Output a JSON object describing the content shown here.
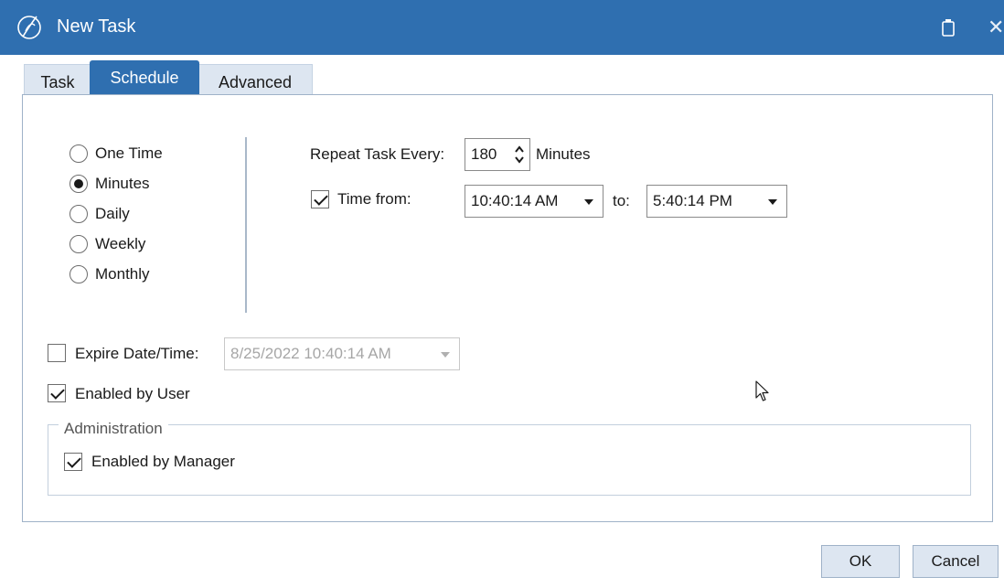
{
  "window": {
    "title": "New Task",
    "logo_icon": "app-logo-icon",
    "accent": "#2f6fb0"
  },
  "tabs": [
    {
      "label": "Task",
      "active": false
    },
    {
      "label": "Schedule",
      "active": true
    },
    {
      "label": "Advanced",
      "active": false
    }
  ],
  "frequency": {
    "options": [
      {
        "label": "One Time",
        "selected": false
      },
      {
        "label": "Minutes",
        "selected": true
      },
      {
        "label": "Daily",
        "selected": false
      },
      {
        "label": "Weekly",
        "selected": false
      },
      {
        "label": "Monthly",
        "selected": false
      }
    ]
  },
  "repeat": {
    "label": "Repeat Task Every:",
    "value": "180",
    "unit": "Minutes"
  },
  "time_range": {
    "checked": true,
    "label": "Time from:",
    "from": "10:40:14 AM",
    "to_label": "to:",
    "to": "5:40:14 PM"
  },
  "expire": {
    "checked": false,
    "label": "Expire Date/Time:",
    "value": "8/25/2022 10:40:14 AM",
    "enabled": false
  },
  "enabled_by_user": {
    "checked": true,
    "label": "Enabled by User"
  },
  "administration": {
    "legend": "Administration",
    "enabled_by_manager": {
      "checked": true,
      "label": "Enabled by Manager"
    }
  },
  "buttons": {
    "ok": "OK",
    "cancel": "Cancel"
  }
}
